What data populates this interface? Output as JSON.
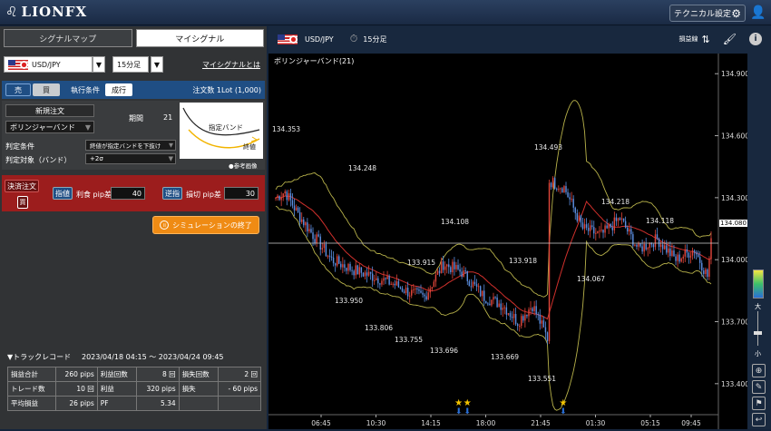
{
  "header": {
    "brand": "LIONFX",
    "technical_settings_label": "テクニカル設定"
  },
  "left_panel": {
    "tabs": [
      {
        "label": "シグナルマップ",
        "active": false
      },
      {
        "label": "マイシグナル",
        "active": true
      }
    ],
    "currency_pair": "USD/JPY",
    "timeframe": "15分足",
    "my_signal_link": "マイシグナルとは",
    "sell_label": "売",
    "buy_label": "買",
    "exec_condition_label": "執行条件",
    "exec_condition_value": "成行",
    "order_qty": "注文数 1Lot (1,000)",
    "new_order_label": "新規注文",
    "indicator_select": "ボリンジャーバンド",
    "period_label": "期間",
    "period_value": "21",
    "judge_condition_label": "判定条件",
    "judge_condition_value": "終値が指定バンドを下抜け",
    "judge_target_label": "判定対象（バンド）",
    "judge_target_value": "+2σ",
    "diagram_band_label": "指定バンド",
    "diagram_close_label": "終値",
    "reference_image_label": "●参考画像",
    "settle_order_label": "決済注文",
    "settle_side": "買",
    "limit_label": "指値",
    "take_profit_label": "利食 pip差",
    "take_profit_value": "40",
    "stop_label": "逆指",
    "stop_loss_label": "損切 pip差",
    "stop_loss_value": "30",
    "simulation_end_label": "シミュレーションの終了",
    "track_record_title": "▼トラックレコード",
    "track_record_period": "2023/04/18 04:15 ～ 2023/04/24 09:45",
    "stats": [
      [
        "損益合計",
        "260 pips",
        "利益回数",
        "8 回",
        "損失回数",
        "2 回"
      ],
      [
        "トレード数",
        "10 回",
        "利益",
        "320 pips",
        "損失",
        "- 60 pips"
      ],
      [
        "平均損益",
        "26 pips",
        "PF",
        "5.34",
        "",
        ""
      ]
    ]
  },
  "chart_panel": {
    "currency_pair": "USD/JPY",
    "timeframe": "15分足",
    "pl_line_label": "損益線",
    "indicator_label": "ボリンジャーバンド(21)",
    "current_price": "134.080",
    "depth_high": "大",
    "depth_low": "小"
  },
  "chart_data": {
    "type": "candlestick",
    "y_ticks": [
      "134.900",
      "134.600",
      "134.300",
      "134.000",
      "133.700",
      "133.400"
    ],
    "ylim": [
      133.25,
      134.98
    ],
    "x_ticks": [
      "06:45",
      "10:30",
      "14:15",
      "18:00",
      "21:45",
      "01:30",
      "05:15",
      "09:45"
    ],
    "price_labels": [
      {
        "text": "134.353",
        "v": 134.353
      },
      {
        "text": "134.248",
        "v": 134.248
      },
      {
        "text": "134.108",
        "v": 134.108
      },
      {
        "text": "133.915",
        "v": 133.915
      },
      {
        "text": "133.950",
        "v": 133.95
      },
      {
        "text": "133.806",
        "v": 133.806
      },
      {
        "text": "133.755",
        "v": 133.755
      },
      {
        "text": "133.696",
        "v": 133.696
      },
      {
        "text": "133.918",
        "v": 133.918
      },
      {
        "text": "133.669",
        "v": 133.669
      },
      {
        "text": "134.493",
        "v": 134.493
      },
      {
        "text": "133.551",
        "v": 133.551
      },
      {
        "text": "134.218",
        "v": 134.218
      },
      {
        "text": "134.067",
        "v": 134.067
      },
      {
        "text": "134.118",
        "v": 134.118
      }
    ],
    "anchors": [
      [
        0,
        134.3
      ],
      [
        5,
        134.33
      ],
      [
        12,
        134.22
      ],
      [
        20,
        134.12
      ],
      [
        30,
        134.0
      ],
      [
        42,
        133.95
      ],
      [
        52,
        133.92
      ],
      [
        64,
        133.88
      ],
      [
        72,
        133.84
      ],
      [
        80,
        133.82
      ],
      [
        90,
        133.98
      ],
      [
        100,
        133.94
      ],
      [
        112,
        133.82
      ],
      [
        122,
        133.78
      ],
      [
        130,
        133.7
      ],
      [
        138,
        133.78
      ],
      [
        146,
        133.62
      ],
      [
        147,
        134.38
      ],
      [
        155,
        134.35
      ],
      [
        165,
        134.15
      ],
      [
        175,
        134.12
      ],
      [
        185,
        134.2
      ],
      [
        195,
        134.05
      ],
      [
        205,
        134.1
      ],
      [
        215,
        134.0
      ],
      [
        225,
        134.05
      ],
      [
        232,
        133.92
      ],
      [
        234,
        134.08
      ]
    ],
    "sell_signal_markers": [
      0.42,
      0.44,
      0.66
    ]
  }
}
